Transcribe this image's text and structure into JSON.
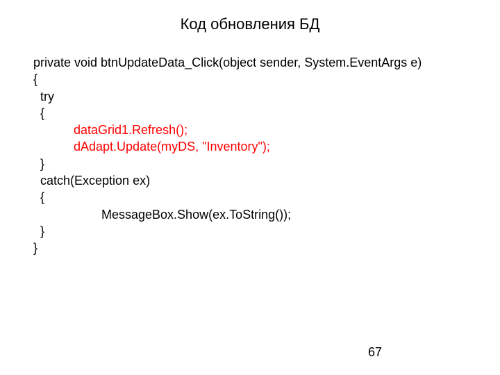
{
  "title": "Код обновления БД",
  "code": {
    "l1": "private void btnUpdateData_Click(object sender, System.EventArgs e)",
    "l2": "{",
    "l3": "try",
    "l4": "{",
    "l5": "dataGrid1.Refresh();",
    "l6": "dAdapt.Update(myDS, \"Inventory\");",
    "l7": "}",
    "l8": "catch(Exception ex)",
    "l9": "{",
    "l10": "MessageBox.Show(ex.ToString());",
    "l11": "}",
    "l12": "}"
  },
  "page_number": "67"
}
